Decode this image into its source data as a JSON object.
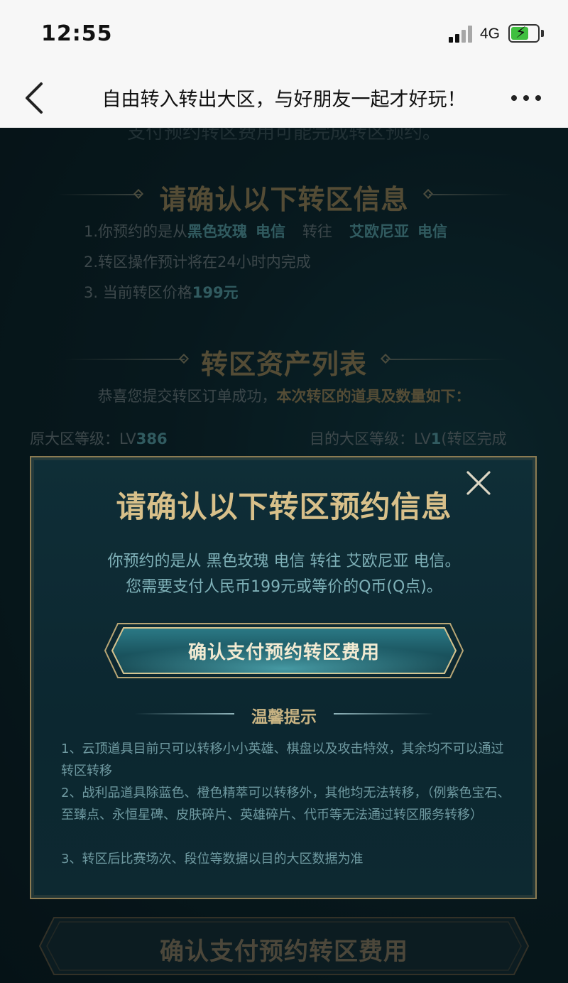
{
  "status_bar": {
    "time": "12:55",
    "network": "4G"
  },
  "nav": {
    "title": "自由转入转出大区，与好朋友一起才好玩！"
  },
  "background": {
    "cut_text": "支付预约转区费用可能完成转区预约。",
    "confirm_section": {
      "title": "请确认以下转区信息",
      "line1_prefix": "1.你预约的是从",
      "from_region": "黑色玫瑰",
      "from_carrier": "电信",
      "to_word": "转往",
      "to_region": "艾欧尼亚",
      "to_carrier": "电信",
      "line2": "2.转区操作预计将在24小时内完成",
      "line3_prefix": "3. 当前转区价格",
      "price": "199元"
    },
    "assets_section": {
      "title": "转区资产列表",
      "subtitle_prefix": "恭喜您提交转区订单成功，",
      "subtitle_strong": "本次转区的道具及数量如下：",
      "origin_level_label": "原大区等级：LV",
      "origin_level_value": "386",
      "target_level_label": "目的大区等级：LV",
      "target_level_value": "1",
      "target_level_suffix": "(转区完成"
    },
    "bottom_button": "确认支付预约转区费用"
  },
  "modal": {
    "title": "请确认以下转区预约信息",
    "desc_line1": "你预约的是从 黑色玫瑰 电信 转往 艾欧尼亚 电信。",
    "desc_line2": "您需要支付人民币199元或等价的Q币(Q点)。",
    "pay_button": "确认支付预约转区费用",
    "tips_title": "温馨提示",
    "tips": [
      "1、云顶道具目前只可以转移小小英雄、棋盘以及攻击特效，其余均不可以通过转区转移",
      "2、战利品道具除蓝色、橙色精萃可以转移外，其他均无法转移，（例紫色宝石、至臻点、永恒星碑、皮肤碎片、英雄碎片、代币等无法通过转区服务转移）",
      "3、转区后比赛场次、段位等数据以目的大区数据为准"
    ]
  },
  "colors": {
    "accent_gold": "#d8c08a",
    "accent_teal": "#7fb1b8",
    "highlight": "#5aa7b0",
    "modal_border": "#8b7b52",
    "background": "#0d2a33"
  },
  "icons": [
    "chevron-left-icon",
    "more-dots-icon",
    "close-icon",
    "signal-icon",
    "battery-icon"
  ]
}
